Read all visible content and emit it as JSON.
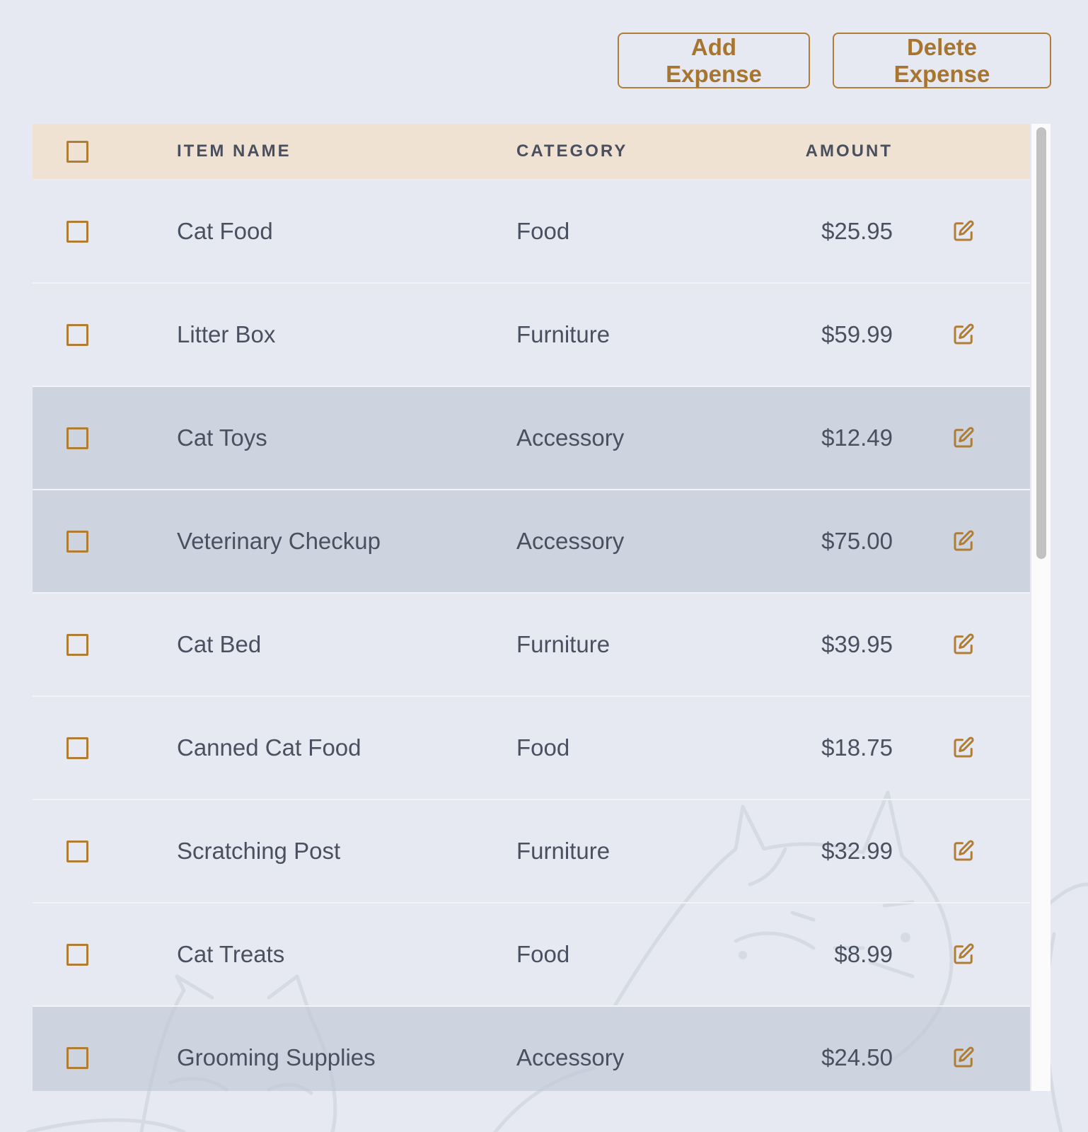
{
  "toolbar": {
    "add_label": "Add Expense",
    "delete_label": "Delete Expense"
  },
  "table": {
    "headers": {
      "item_name": "ITEM NAME",
      "category": "CATEGORY",
      "amount": "AMOUNT"
    },
    "rows": [
      {
        "name": "Cat Food",
        "category": "Food",
        "amount": "$25.95",
        "highlighted": false,
        "checked": false
      },
      {
        "name": "Litter Box",
        "category": "Furniture",
        "amount": "$59.99",
        "highlighted": false,
        "checked": false
      },
      {
        "name": "Cat Toys",
        "category": "Accessory",
        "amount": "$12.49",
        "highlighted": true,
        "checked": false
      },
      {
        "name": "Veterinary Checkup",
        "category": "Accessory",
        "amount": "$75.00",
        "highlighted": true,
        "checked": false
      },
      {
        "name": "Cat Bed",
        "category": "Furniture",
        "amount": "$39.95",
        "highlighted": false,
        "checked": false
      },
      {
        "name": "Canned Cat Food",
        "category": "Food",
        "amount": "$18.75",
        "highlighted": false,
        "checked": false
      },
      {
        "name": "Scratching Post",
        "category": "Furniture",
        "amount": "$32.99",
        "highlighted": false,
        "checked": false
      },
      {
        "name": "Cat Treats",
        "category": "Food",
        "amount": "$8.99",
        "highlighted": false,
        "checked": false
      },
      {
        "name": "Grooming Supplies",
        "category": "Accessory",
        "amount": "$24.50",
        "highlighted": true,
        "checked": false
      }
    ]
  },
  "icons": {
    "row_action": "edit-icon",
    "background": "cat-illustration"
  },
  "colors": {
    "accent": "#b07d35",
    "header_background": "#f0e2d3",
    "selected_row": "#cdd4de",
    "page_background": "#e6e9f1",
    "text": "#4b5060"
  }
}
